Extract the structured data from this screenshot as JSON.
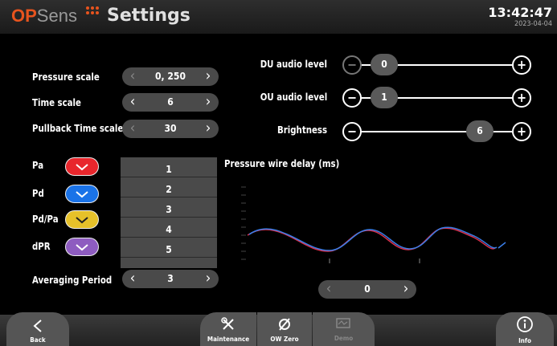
{
  "header": {
    "logo_op": "OP",
    "logo_sens": "Sens",
    "title": "Settings",
    "time": "13:42:47",
    "date": "2023-04-04"
  },
  "left": {
    "pressure_scale": {
      "label": "Pressure scale",
      "value": "0, 250"
    },
    "time_scale": {
      "label": "Time scale",
      "value": "6"
    },
    "pullback_time_scale": {
      "label": "Pullback Time scale",
      "value": "30"
    },
    "channels": [
      {
        "label": "Pa",
        "color": "#e8262c"
      },
      {
        "label": "Pd",
        "color": "#1a73e8"
      },
      {
        "label": "Pd/Pa",
        "color": "#e6c12a"
      },
      {
        "label": "dPR",
        "color": "#8e5cc0"
      }
    ],
    "averaging_list": [
      "1",
      "2",
      "3",
      "4",
      "5"
    ],
    "averaging_period": {
      "label": "Averaging Period",
      "value": "3"
    }
  },
  "right": {
    "du_audio": {
      "label": "DU audio level",
      "value": "0"
    },
    "ou_audio": {
      "label": "OU audio level",
      "value": "1"
    },
    "brightness": {
      "label": "Brightness",
      "value": "6"
    },
    "wire_delay": {
      "label": "Pressure wire delay (ms)",
      "value": "0"
    }
  },
  "footer": {
    "back": "Back",
    "maintenance": "Maintenance",
    "ow_zero": "OW Zero",
    "demo": "Demo",
    "info": "Info"
  }
}
